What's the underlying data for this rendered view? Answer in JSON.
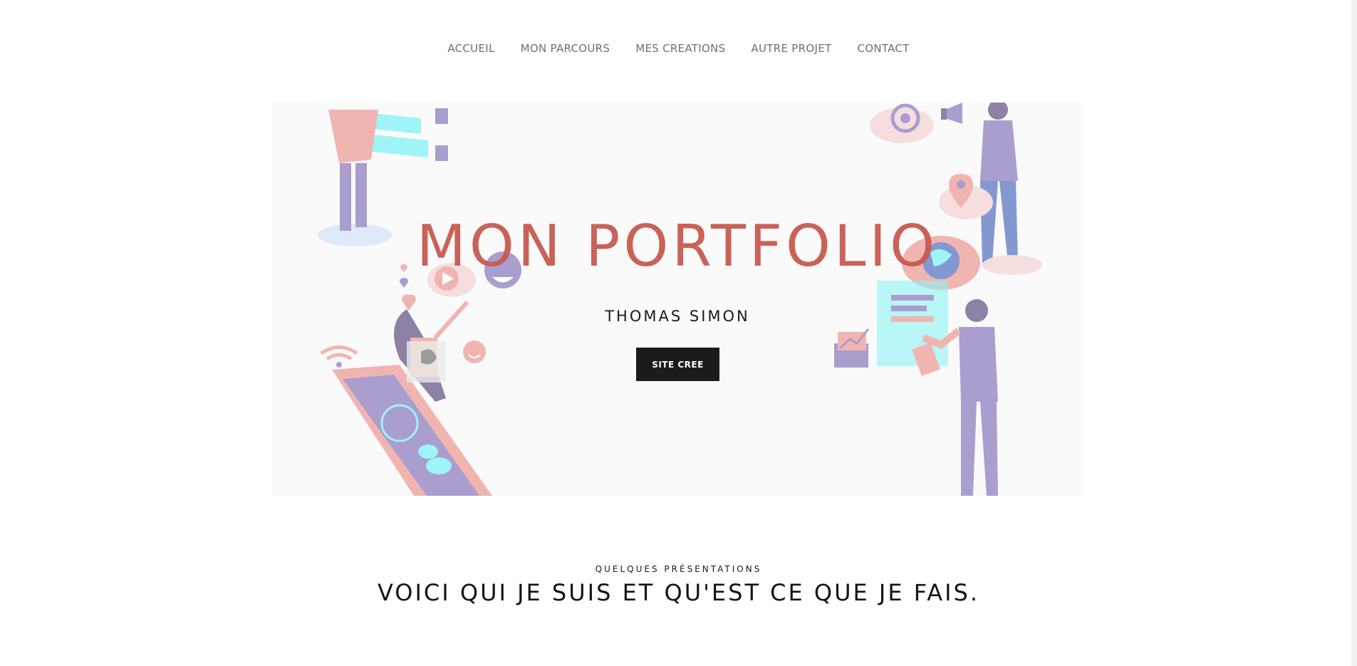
{
  "nav": {
    "items": [
      {
        "label": "ACCUEIL"
      },
      {
        "label": "MON PARCOURS"
      },
      {
        "label": "MES CREATIONS"
      },
      {
        "label": "AUTRE PROJET"
      },
      {
        "label": "CONTACT"
      }
    ]
  },
  "hero": {
    "title": "MON PORTFOLIO",
    "subtitle": "THOMAS SIMON",
    "button_label": "SITE CREE",
    "illustration_icons": [
      "at-sign-icon",
      "megaphone-icon",
      "location-pin-icon",
      "globe-icon",
      "heart-icon",
      "play-icon",
      "smiley-icon",
      "wifi-icon",
      "chart-envelope-icon",
      "checklist-icon"
    ]
  },
  "colors": {
    "accent": "#c85a50",
    "button_bg": "#1b1b1b",
    "nav_text": "#6f6f6f",
    "hero_bg": "#fafafa",
    "illustration_pink": "#f0a9a5",
    "illustration_purple": "#9b8fc7",
    "illustration_cyan": "#8ff3f7"
  },
  "presentation": {
    "kicker": "QUELQUES PRÉSENTATIONS",
    "heading": "VOICI QUI JE SUIS ET QU'EST CE QUE JE FAIS."
  }
}
